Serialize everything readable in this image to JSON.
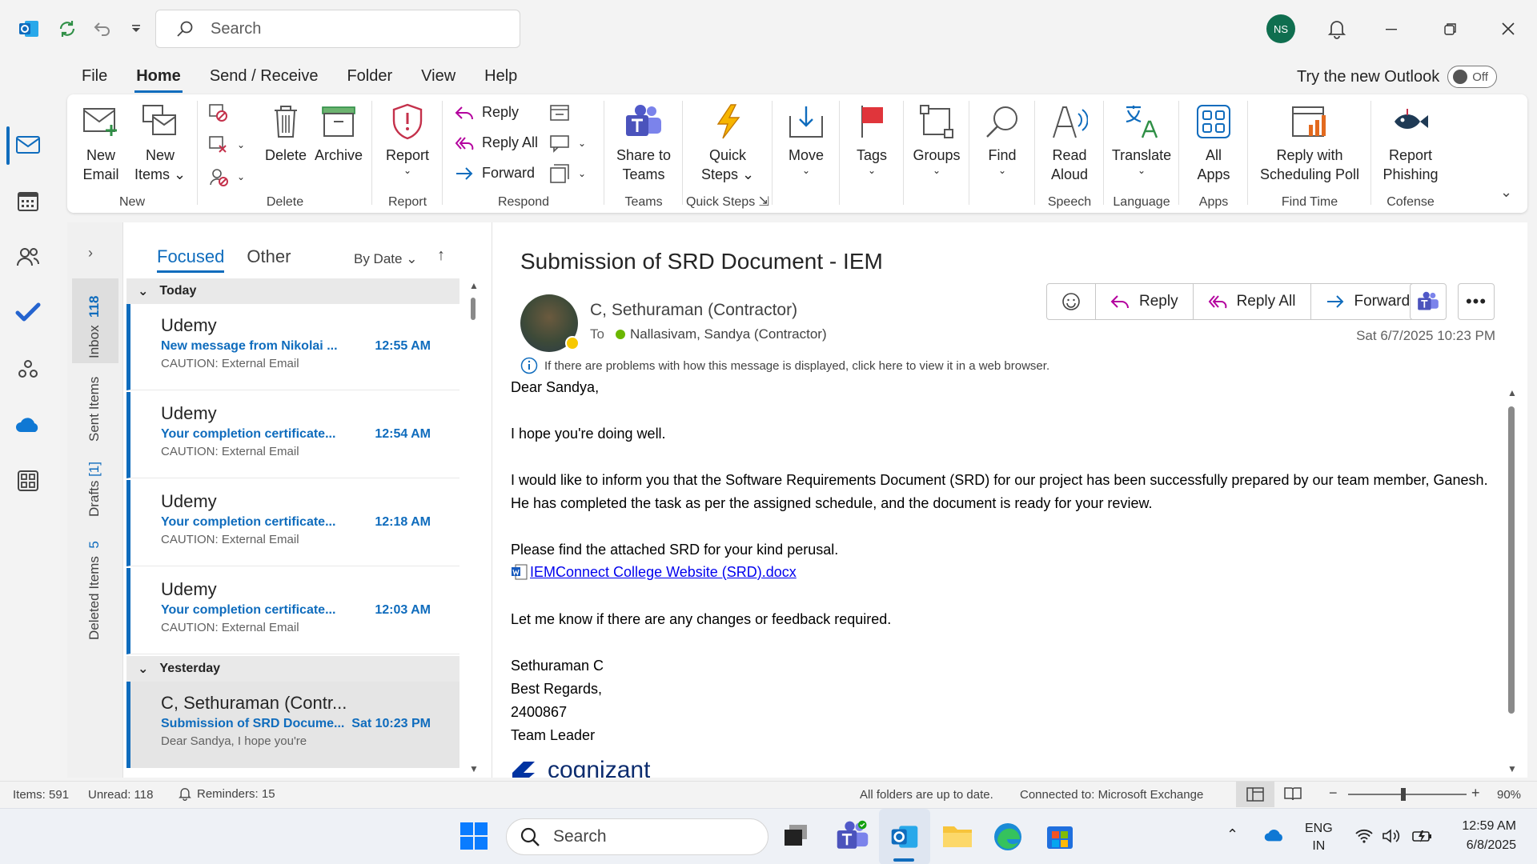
{
  "titlebar": {
    "search_placeholder": "Search",
    "avatar_initials": "NS"
  },
  "menu": {
    "tabs": [
      "File",
      "Home",
      "Send / Receive",
      "Folder",
      "View",
      "Help"
    ],
    "try_new": "Try the new Outlook",
    "toggle_label": "Off"
  },
  "ribbon": {
    "new": {
      "group": "New",
      "new_email": [
        "New",
        "Email"
      ],
      "new_items": [
        "New",
        "Items"
      ]
    },
    "delete": {
      "group": "Delete",
      "delete": "Delete",
      "archive": "Archive"
    },
    "report": {
      "group": "Report",
      "report": "Report"
    },
    "respond": {
      "group": "Respond",
      "reply": "Reply",
      "reply_all": "Reply All",
      "forward": "Forward"
    },
    "teams": {
      "group": "Teams",
      "share": [
        "Share to",
        "Teams"
      ]
    },
    "quick_steps": {
      "group": "Quick Steps",
      "label": [
        "Quick",
        "Steps"
      ]
    },
    "move": {
      "label": "Move"
    },
    "tags": {
      "label": "Tags"
    },
    "groups": {
      "label": "Groups"
    },
    "find": {
      "label": "Find"
    },
    "speech": {
      "group": "Speech",
      "label": [
        "Read",
        "Aloud"
      ]
    },
    "language": {
      "group": "Language",
      "label": "Translate"
    },
    "apps": {
      "group": "Apps",
      "label": [
        "All",
        "Apps"
      ]
    },
    "findtime": {
      "group": "Find Time",
      "label": [
        "Reply with",
        "Scheduling Poll"
      ]
    },
    "cofense": {
      "group": "Cofense",
      "label": [
        "Report",
        "Phishing"
      ]
    }
  },
  "folders": {
    "inbox": "Inbox",
    "inbox_count": "118",
    "sent": "Sent Items",
    "drafts": "Drafts",
    "drafts_count": "[1]",
    "deleted": "Deleted Items",
    "deleted_count": "5"
  },
  "message_list": {
    "tab_focused": "Focused",
    "tab_other": "Other",
    "sort": "By Date",
    "group_today": "Today",
    "group_yesterday": "Yesterday",
    "items": [
      {
        "from": "Udemy",
        "subject": "New message from Nikolai ...",
        "time": "12:55 AM",
        "preview": "CAUTION: External Email"
      },
      {
        "from": "Udemy",
        "subject": "Your completion certificate...",
        "time": "12:54 AM",
        "preview": "CAUTION: External Email"
      },
      {
        "from": "Udemy",
        "subject": "Your completion certificate...",
        "time": "12:18 AM",
        "preview": "CAUTION: External Email"
      },
      {
        "from": "Udemy",
        "subject": "Your completion certificate...",
        "time": "12:03 AM",
        "preview": "CAUTION: External Email"
      },
      {
        "from": "C, Sethuraman (Contr...",
        "subject": "Submission of SRD Docume...",
        "time": "Sat 10:23 PM",
        "preview": "Dear Sandya,  I hope you're"
      }
    ]
  },
  "reading": {
    "subject": "Submission of SRD Document - IEM",
    "sender": "C, Sethuraman (Contractor)",
    "to_label": "To",
    "recipient": "Nallasivam, Sandya (Contractor)",
    "date": "Sat 6/7/2025 10:23 PM",
    "info": "If there are problems with how this message is displayed, click here to view it in a web browser.",
    "actions": {
      "reply": "Reply",
      "reply_all": "Reply All",
      "forward": "Forward"
    },
    "body": {
      "greeting": "Dear Sandya,",
      "p1": "I hope you're doing well.",
      "p2a": "I would like to inform you that the Software Requirements Document (SRD) for our project has been successfully prepared by our team member, Ganesh.",
      "p2b": "He has completed the task as per the assigned schedule, and the document is ready for your review.",
      "p3": "Please find the attached SRD for your kind perusal.",
      "attachment": "IEMConnect College Website (SRD).docx",
      "p4": "Let me know if there are any changes or feedback required.",
      "sig1": "Sethuraman C",
      "sig2": "Best Regards,",
      "sig3": "2400867",
      "sig4": "Team Leader",
      "logo": "cognizant"
    }
  },
  "statusbar": {
    "items": "Items: 591",
    "unread": "Unread: 118",
    "reminders": "Reminders: 15",
    "sync": "All folders are up to date.",
    "connection": "Connected to: Microsoft Exchange",
    "zoom": "90%"
  },
  "taskbar": {
    "search": "Search",
    "lang1": "ENG",
    "lang2": "IN",
    "time": "12:59 AM",
    "date": "6/8/2025"
  }
}
